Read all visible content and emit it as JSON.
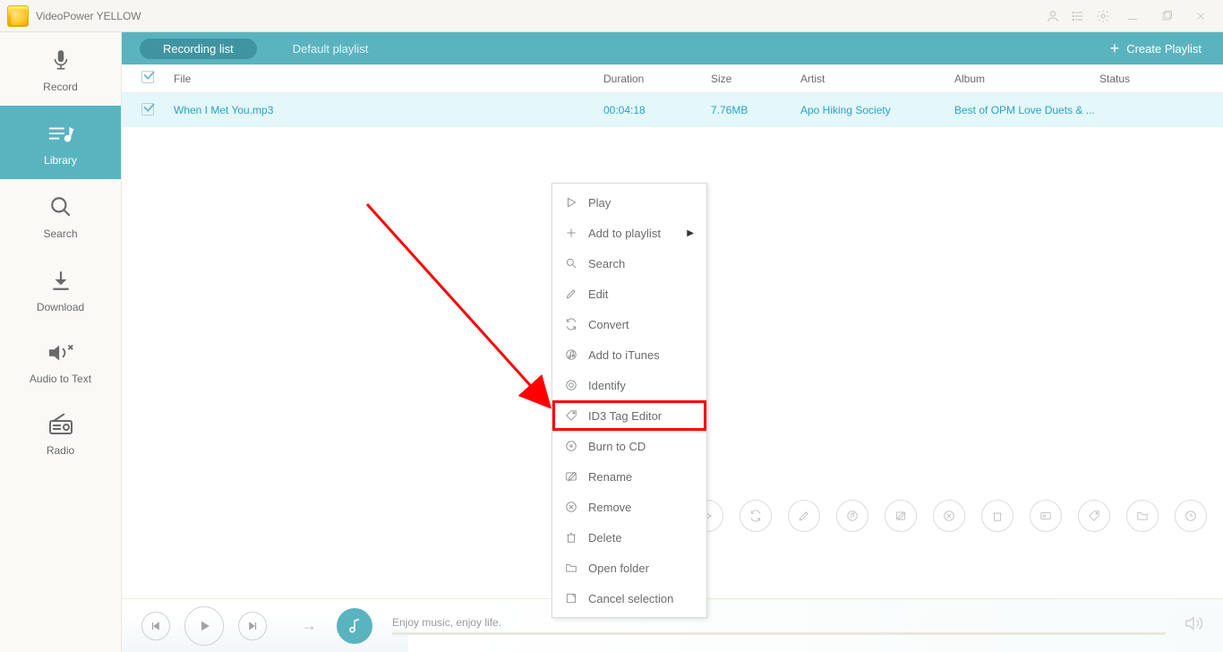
{
  "app_title": "VideoPower YELLOW",
  "tabs": {
    "recording_list": "Recording list",
    "default_playlist": "Default playlist",
    "create_playlist": "Create Playlist"
  },
  "sidebar": {
    "record": "Record",
    "library": "Library",
    "search": "Search",
    "download": "Download",
    "audio_to_text": "Audio to Text",
    "radio": "Radio"
  },
  "columns": {
    "file": "File",
    "duration": "Duration",
    "size": "Size",
    "artist": "Artist",
    "album": "Album",
    "status": "Status"
  },
  "rows": [
    {
      "file": "When I Met You.mp3",
      "duration": "00:04:18",
      "size": "7.76MB",
      "artist": "Apo Hiking Society",
      "album": "Best of OPM Love Duets & ...",
      "status": ""
    }
  ],
  "context_menu": {
    "play": "Play",
    "add_to_playlist": "Add to playlist",
    "search": "Search",
    "edit": "Edit",
    "convert": "Convert",
    "add_to_itunes": "Add to iTunes",
    "identify": "Identify",
    "id3_tag_editor": "ID3 Tag Editor",
    "burn_to_cd": "Burn to CD",
    "rename": "Rename",
    "remove": "Remove",
    "delete": "Delete",
    "open_folder": "Open folder",
    "cancel_selection": "Cancel selection"
  },
  "player": {
    "now_playing": "Enjoy music, enjoy life."
  }
}
